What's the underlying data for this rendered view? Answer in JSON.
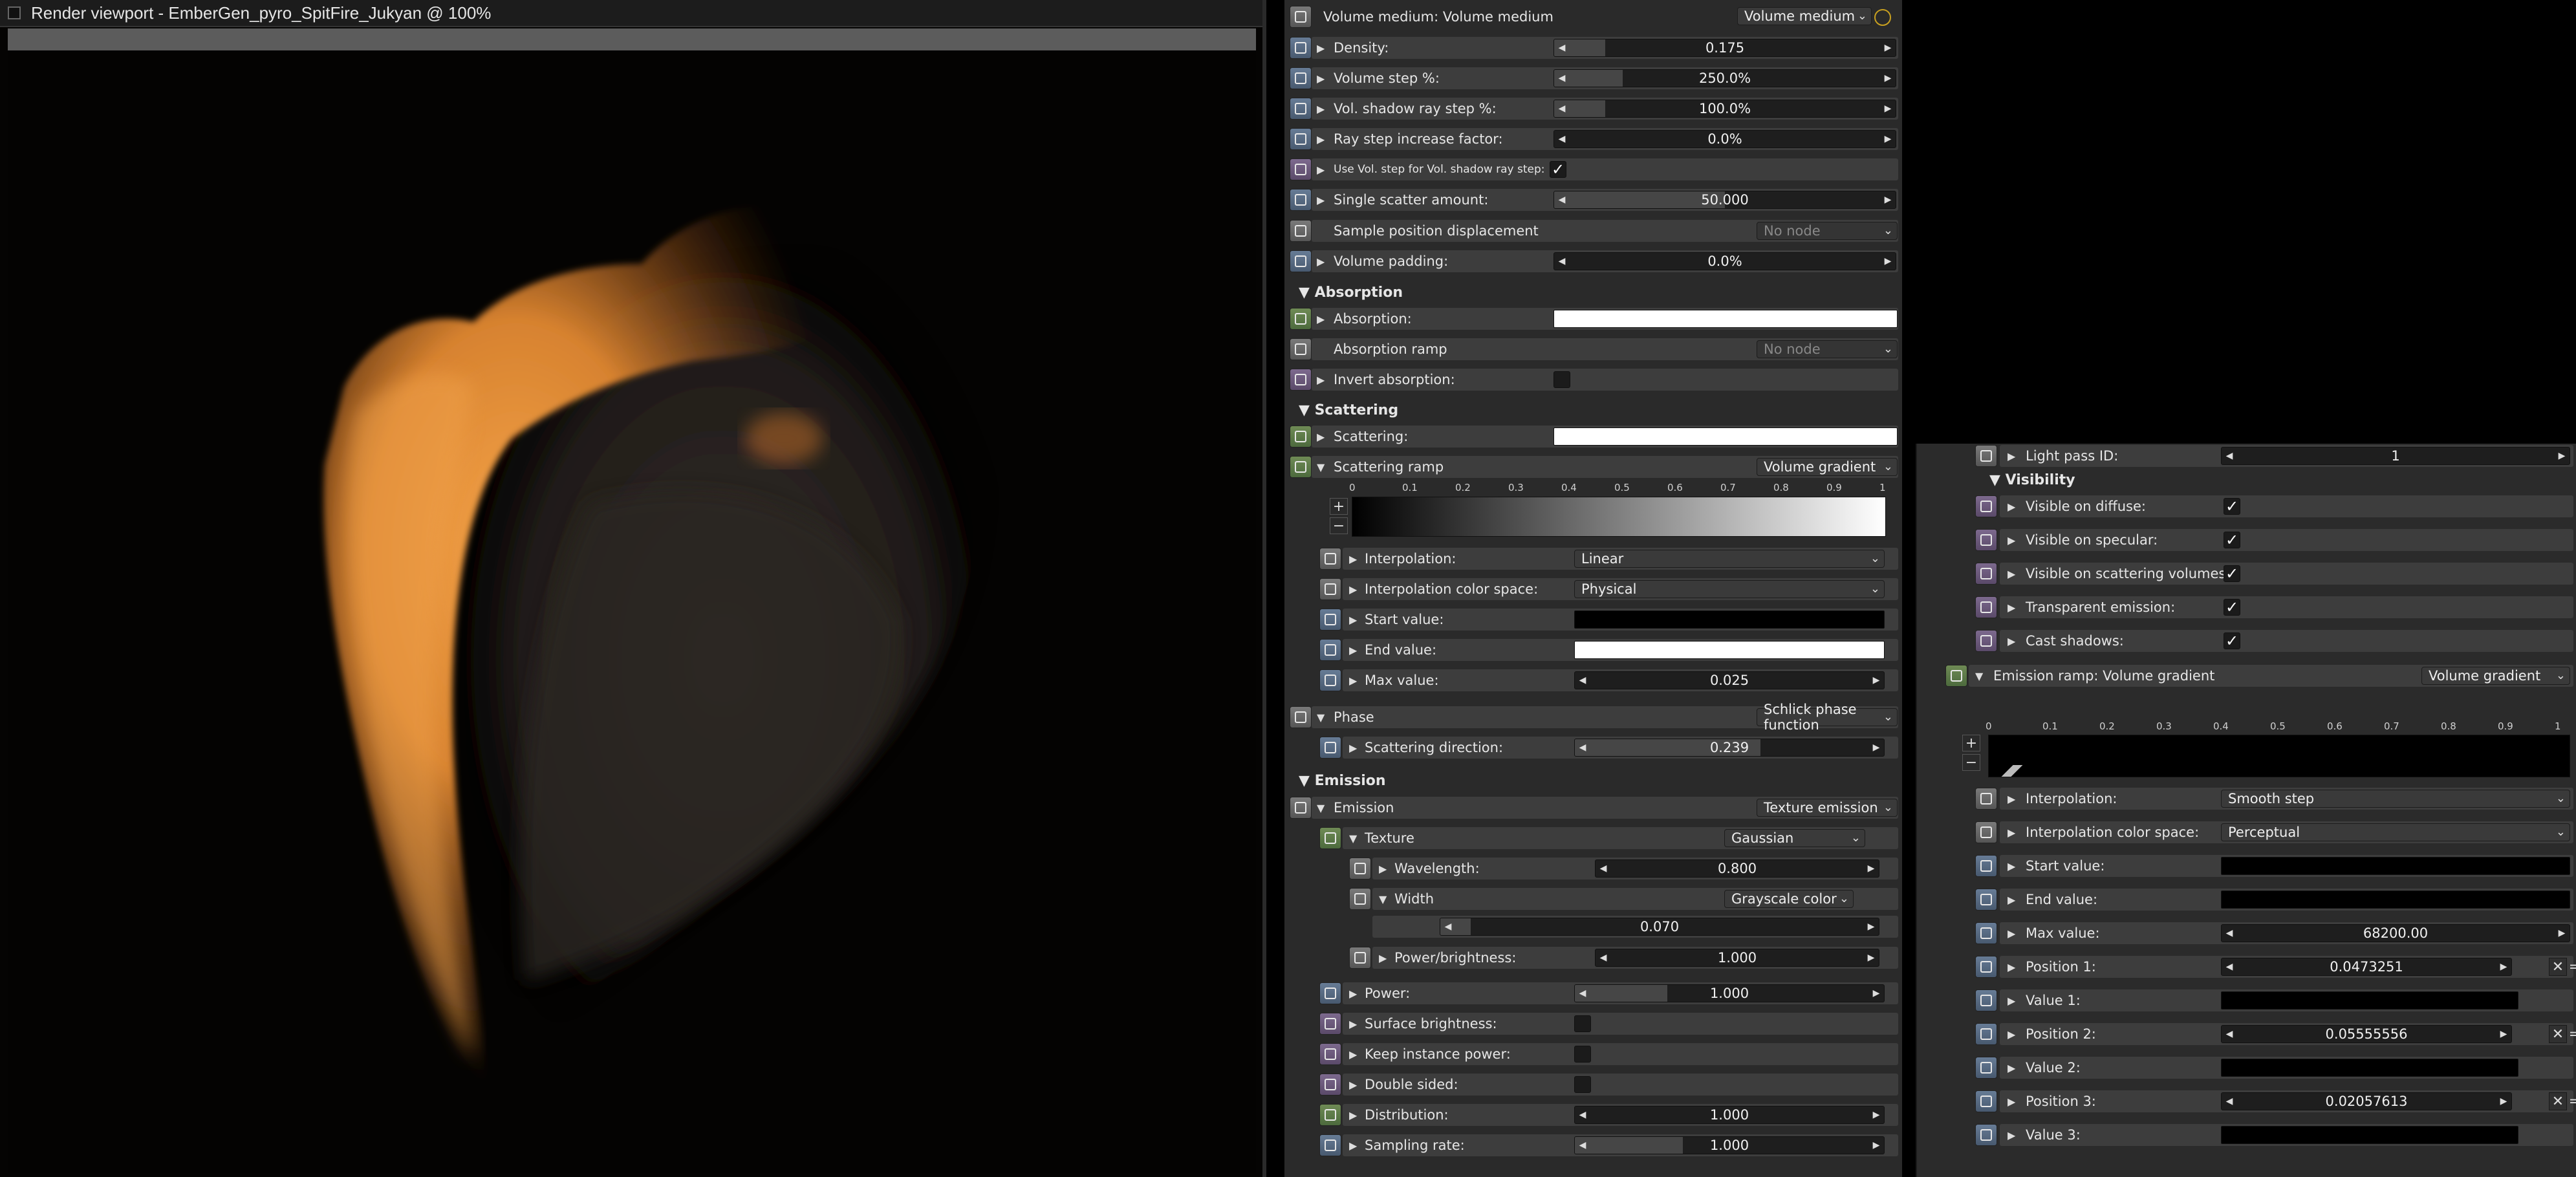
{
  "viewport": {
    "title": "Render viewport - EmberGen_pyro_SpitFire_Jukyan @ 100%"
  },
  "left": {
    "header": {
      "title": "Volume medium: Volume medium",
      "node_type": "Volume medium"
    },
    "density": {
      "label": "Density:",
      "value": "0.175",
      "fill": 0.15
    },
    "volume_step": {
      "label": "Volume step %:",
      "value": "250.0%",
      "fill": 0.2
    },
    "vol_shadow_step": {
      "label": "Vol. shadow ray step %:",
      "value": "100.0%",
      "fill": 0.15
    },
    "ray_step_increase": {
      "label": "Ray step increase factor:",
      "value": "0.0%",
      "fill": 0.0
    },
    "use_vol_step": {
      "label": "Use Vol. step for Vol. shadow ray step:",
      "checked": "✓"
    },
    "single_scatter": {
      "label": "Single scatter amount:",
      "value": "50.000",
      "fill": 0.5
    },
    "sample_pos_disp": {
      "label": "Sample position displacement",
      "node": "No node"
    },
    "volume_padding": {
      "label": "Volume padding:",
      "value": "0.0%",
      "fill": 0.0
    },
    "absorption_section": "Absorption",
    "absorption": {
      "label": "Absorption:",
      "color": "#ffffff"
    },
    "absorption_ramp": {
      "label": "Absorption ramp",
      "node": "No node"
    },
    "invert_absorption": {
      "label": "Invert absorption:"
    },
    "scattering_section": "Scattering",
    "scattering": {
      "label": "Scattering:",
      "color": "#ffffff"
    },
    "scattering_ramp": {
      "label": "Scattering ramp",
      "node": "Volume gradient"
    },
    "ramp_ticks": [
      "0",
      "0.1",
      "0.2",
      "0.3",
      "0.4",
      "0.5",
      "0.6",
      "0.7",
      "0.8",
      "0.9",
      "1"
    ],
    "interpolation": {
      "label": "Interpolation:",
      "value": "Linear"
    },
    "interp_color_space": {
      "label": "Interpolation color space:",
      "value": "Physical"
    },
    "start_value": {
      "label": "Start value:",
      "color": "#000000"
    },
    "end_value": {
      "label": "End value:",
      "color": "#ffffff"
    },
    "max_value": {
      "label": "Max value:",
      "value": "0.025",
      "fill": 0.0
    },
    "phase": {
      "label": "Phase",
      "node": "Schlick phase function"
    },
    "scattering_direction": {
      "label": "Scattering direction:",
      "value": "0.239",
      "fill": 0.6
    },
    "emission_section": "Emission",
    "emission": {
      "label": "Emission",
      "node": "Texture emission"
    },
    "texture": {
      "label": "Texture",
      "node": "Gaussian"
    },
    "wavelength": {
      "label": "Wavelength:",
      "value": "0.800",
      "fill": 0.0
    },
    "width": {
      "label": "Width",
      "node": "Grayscale color",
      "value": "0.070",
      "fill": 0.07
    },
    "power_brightness": {
      "label": "Power/brightness:",
      "value": "1.000",
      "fill": 0.0
    },
    "power": {
      "label": "Power:",
      "value": "1.000",
      "fill": 0.3
    },
    "surface_brightness": {
      "label": "Surface brightness:"
    },
    "keep_instance_power": {
      "label": "Keep instance power:"
    },
    "double_sided": {
      "label": "Double sided:"
    },
    "distribution": {
      "label": "Distribution:",
      "value": "1.000",
      "fill": 0.0
    },
    "sampling_rate": {
      "label": "Sampling rate:",
      "value": "1.000",
      "fill": 0.35
    }
  },
  "right": {
    "light_pass_id": {
      "label": "Light pass ID:",
      "value": "1"
    },
    "visibility_section": "Visibility",
    "visible_diffuse": {
      "label": "Visible on diffuse:",
      "checked": "✓"
    },
    "visible_specular": {
      "label": "Visible on specular:",
      "checked": "✓"
    },
    "visible_scattering": {
      "label": "Visible on scattering volumes:",
      "checked": "✓"
    },
    "transparent_emission": {
      "label": "Transparent emission:",
      "checked": "✓"
    },
    "cast_shadows": {
      "label": "Cast shadows:",
      "checked": "✓"
    },
    "emission_ramp": {
      "label": "Emission ramp: Volume gradient",
      "node": "Volume gradient"
    },
    "ramp_ticks": [
      "0",
      "0.1",
      "0.2",
      "0.3",
      "0.4",
      "0.5",
      "0.6",
      "0.7",
      "0.8",
      "0.9",
      "1"
    ],
    "interpolation": {
      "label": "Interpolation:",
      "value": "Smooth step"
    },
    "interp_color_space": {
      "label": "Interpolation color space:",
      "value": "Perceptual"
    },
    "start_value": {
      "label": "Start value:",
      "color": "#000000"
    },
    "end_value": {
      "label": "End value:",
      "color": "#000000"
    },
    "max_value": {
      "label": "Max value:",
      "value": "68200.00"
    },
    "position1": {
      "label": "Position 1:",
      "value": "0.0473251"
    },
    "value1": {
      "label": "Value 1:",
      "color": "#000000"
    },
    "position2": {
      "label": "Position 2:",
      "value": "0.05555556"
    },
    "value2": {
      "label": "Value 2:",
      "color": "#000000"
    },
    "position3": {
      "label": "Position 3:",
      "value": "0.02057613"
    },
    "value3": {
      "label": "Value 3:",
      "color": "#000000"
    }
  },
  "colors": {
    "panel": "#2a2a2a",
    "row": "#3d3d3d",
    "fire": "#e8913a",
    "smoke": "#3a3430"
  }
}
